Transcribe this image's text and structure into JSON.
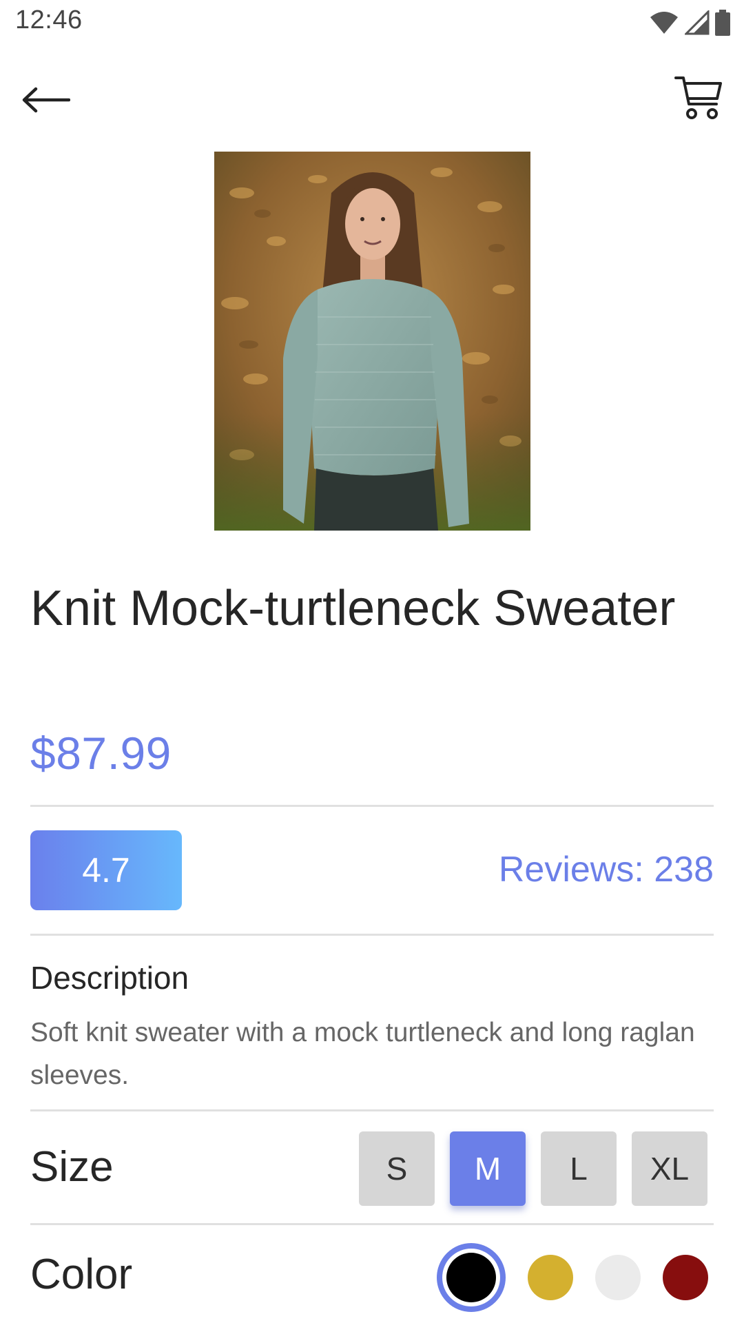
{
  "status_bar": {
    "time": "12:46",
    "icons": [
      "wifi-icon",
      "cellular-signal-icon",
      "battery-icon"
    ]
  },
  "app_bar": {
    "back_icon": "arrow-left-icon",
    "cart_icon": "shopping-cart-icon"
  },
  "product": {
    "image_alt": "Woman wearing a light teal knit sweater in autumn leaves",
    "title": "Knit Mock-turtleneck Sweater",
    "price": "$87.99",
    "rating": "4.7",
    "reviews": "Reviews: 238",
    "description_heading": "Description",
    "description": "Soft knit sweater with a mock turtleneck and long raglan sleeves."
  },
  "size": {
    "label": "Size",
    "options": [
      "S",
      "M",
      "L",
      "XL"
    ],
    "selected": "M"
  },
  "color": {
    "label": "Color",
    "options": [
      "#000000",
      "#d4b02f",
      "#ebebeb",
      "#870e0e"
    ],
    "selected": "#000000"
  },
  "theme": {
    "accent": "#6b7fe8",
    "gradient_end": "#67b8fc"
  }
}
